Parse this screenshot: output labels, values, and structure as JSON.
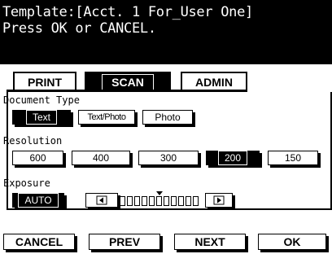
{
  "header": {
    "line1": "Template:[Acct. 1 For_User One]",
    "line2": "Press OK or CANCEL."
  },
  "tabs": [
    {
      "label": "PRINT",
      "selected": false
    },
    {
      "label": "SCAN",
      "selected": true
    },
    {
      "label": "ADMIN",
      "selected": false
    }
  ],
  "document_type": {
    "label": "Document Type",
    "options": [
      {
        "label": "Text",
        "selected": true
      },
      {
        "label": "Text/Photo",
        "selected": false
      },
      {
        "label": "Photo",
        "selected": false
      }
    ]
  },
  "resolution": {
    "label": "Resolution",
    "options": [
      {
        "label": "600",
        "selected": false
      },
      {
        "label": "400",
        "selected": false
      },
      {
        "label": "300",
        "selected": false
      },
      {
        "label": "200",
        "selected": true
      },
      {
        "label": "150",
        "selected": false
      }
    ]
  },
  "exposure": {
    "label": "Exposure",
    "auto_label": "AUTO",
    "auto_selected": true,
    "levels": 11,
    "current_level": 6,
    "left_icon": "arrow-left-icon",
    "right_icon": "arrow-right-icon"
  },
  "buttons": {
    "cancel": "CANCEL",
    "prev": "PREV",
    "next": "NEXT",
    "ok": "OK"
  }
}
